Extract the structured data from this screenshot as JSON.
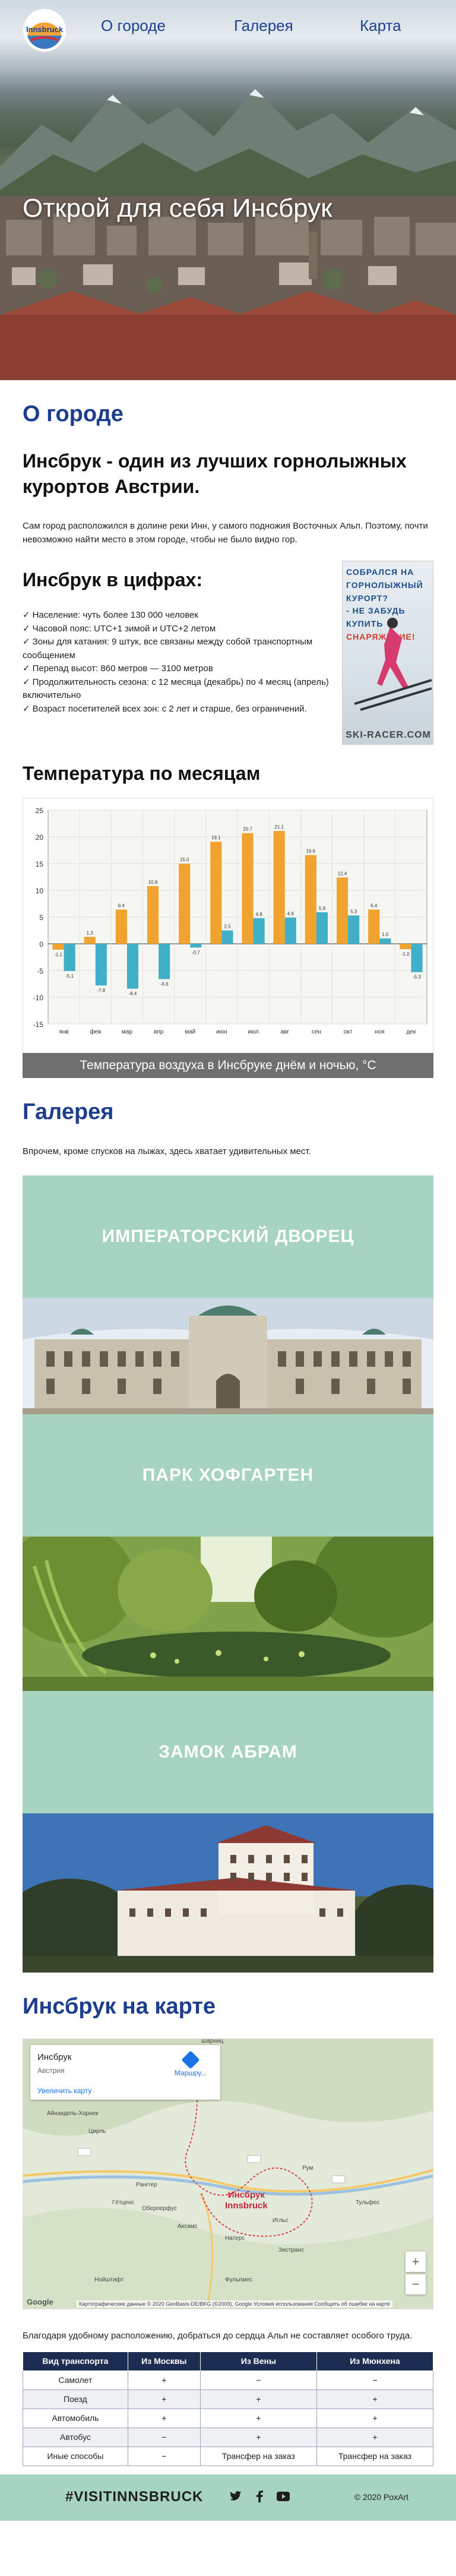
{
  "nav": {
    "logo_text": "Innsbruck",
    "links": [
      "О городе",
      "Галерея",
      "Карта"
    ]
  },
  "hero": {
    "title": "Открой для себя Инсбрук"
  },
  "about": {
    "heading": "О городе",
    "intro_heading": "Инсбрук - один из лучших горнолыжных курортов Австрии.",
    "intro_text": "Сам город расположился в долине реки Инн, у самого подножия Восточных Альп. Поэтому, почти невозможно найти место в этом городе, чтобы не было видно гор."
  },
  "numbers": {
    "heading": "Инсбрук в цифрах:",
    "facts": [
      "Население: чуть более 130 000 человек",
      "Часовой пояс: UTC+1 зимой и UTC+2 летом",
      "Зоны для катания: 9 штук, все связаны между собой транспортным сообщением",
      "Перепад высот: 860 метров — 3100 метров",
      "Продолжительность сезона: с 12 месяца (декабрь) по 4 месяц (апрель) включительно",
      "Возраст посетителей всех зон: с 2 лет и старше, без ограничений."
    ]
  },
  "ad": {
    "text_lines": [
      "СОБРАЛСЯ НА",
      "ГОРНОЛЫЖНЫЙ",
      "КУРОРТ?",
      "- НЕ ЗАБУДЬ",
      "КУПИТЬ",
      "СНАРЯЖЕНИЕ!"
    ],
    "brand": "SKI-RACER.COM"
  },
  "temperature": {
    "heading": "Температура по месяцам",
    "caption": "Температура воздуха в Инсбруке днём и ночью, °C"
  },
  "chart_data": {
    "type": "bar",
    "categories": [
      "янв",
      "фев",
      "мар",
      "апр",
      "май",
      "июн",
      "июл",
      "авг",
      "сен",
      "окт",
      "ноя",
      "дек"
    ],
    "series": [
      {
        "name": "",
        "color": "#f0a32e",
        "values": [
          -1.1,
          1.3,
          6.4,
          10.8,
          15.0,
          19.1,
          20.7,
          21.1,
          16.6,
          12.4,
          6.4,
          -1.0
        ]
      },
      {
        "name": "",
        "color": "#3fb0c8",
        "values": [
          -5.1,
          -7.8,
          -8.4,
          -6.6,
          -0.7,
          2.5,
          4.8,
          4.9,
          5.9,
          5.3,
          1.0,
          -5.3
        ]
      }
    ],
    "data_labels": [
      [
        "-1.1",
        "1.3",
        "6.4",
        "10.8",
        "15.0",
        "19.1",
        "20.7",
        "21.1",
        "16.6",
        "12.4",
        "6.4",
        "-1.0"
      ],
      [
        "-5.1",
        "-7.8",
        "-8.4",
        "-6.6",
        "-0.7",
        "2.5",
        "4.8",
        "4.9",
        "5.9",
        "5.3",
        "1.0",
        "-5.3"
      ]
    ],
    "ylim": [
      -15,
      25
    ],
    "yticks": [
      "25",
      "20",
      "15",
      "10",
      "5",
      "0",
      "-5",
      "-10",
      "-15"
    ],
    "grid": true
  },
  "gallery": {
    "heading": "Галерея",
    "intro": "Впрочем, кроме спусков на лыжах, здесь хватает удивительных мест.",
    "items": [
      {
        "title": "ИМПЕРАТОРСКИЙ ДВОРЕЦ"
      },
      {
        "title": "ПАРК ХОФГАРТЕН"
      },
      {
        "title": "ЗАМОК АБРАМ"
      }
    ]
  },
  "map": {
    "heading": "Инсбрук на карте",
    "place": "Инсбрук",
    "country": "Австрия",
    "route_label": "Маршру...",
    "enlarge_label": "Увеличить карту",
    "city_label_1": "Инсбрук",
    "city_label_2": "Innsbruck",
    "attribution": "Картографические данные © 2020 GeoBasis-DE/BKG (©2009), Google   Условия использования   Сообщить об ошибке на карте",
    "google": "Google",
    "zoom_in": "+",
    "zoom_out": "−",
    "labels": [
      "Шарниц",
      "Цирль",
      "Айнзидель-Хорнек",
      "Оберперфус",
      "Аксамс",
      "Нойштифт",
      "Фульпмес",
      "Натерс",
      "Игльс",
      "Рум",
      "Тульфес",
      "Ранггер",
      "Гётценс",
      "Зистранс"
    ]
  },
  "transport": {
    "text": "Благодаря удобному расположению, добраться до сердца Альп не составляет особого труда.",
    "headers": [
      "Вид транспорта",
      "Из Москвы",
      "Из Вены",
      "Из Мюнхена"
    ],
    "rows": [
      [
        "Самолет",
        "+",
        "−",
        "−"
      ],
      [
        "Поезд",
        "+",
        "+",
        "+"
      ],
      [
        "Автомобиль",
        "+",
        "+",
        "+"
      ],
      [
        "Автобус",
        "−",
        "+",
        "+"
      ],
      [
        "Иные способы",
        "−",
        "Трансфер на заказ",
        "Трансфер на заказ"
      ]
    ]
  },
  "footer": {
    "tag": "#VISITINNSBRUCK",
    "social": [
      "twitter-icon",
      "facebook-icon",
      "youtube-icon"
    ],
    "copyright": "© 2020 PoxArt"
  }
}
